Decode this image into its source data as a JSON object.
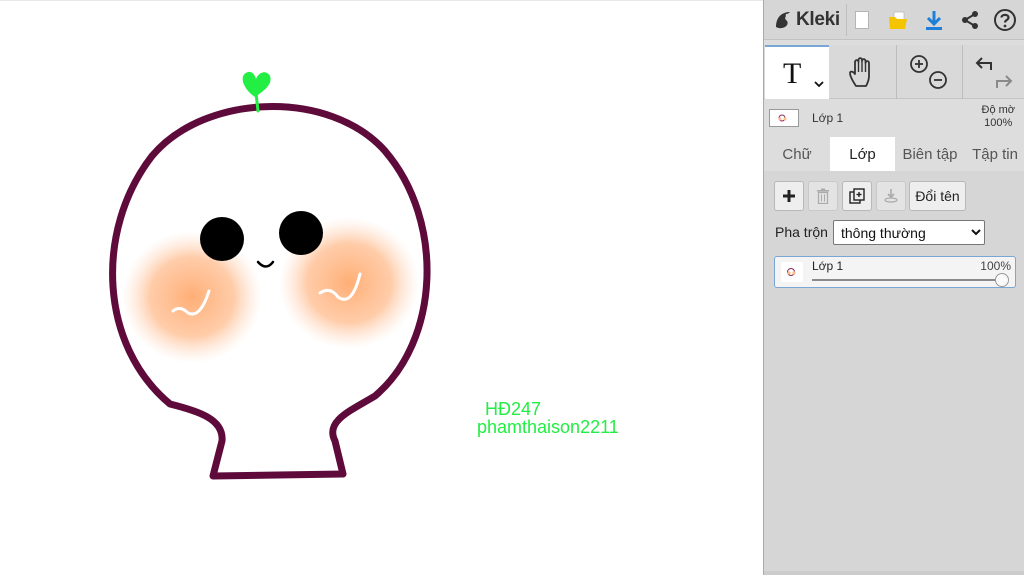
{
  "app": {
    "name": "Kleki"
  },
  "colors": {
    "outline": "#5e0b3b",
    "sprout": "#22ee44",
    "blush": "#ffb98a",
    "panel_bg": "#dddddd",
    "accent": "#1e7fd8",
    "folder": "#f5c400"
  },
  "canvas": {
    "texts": [
      "HĐ247",
      "phamthaison2211"
    ]
  },
  "toolbar": {
    "icons": [
      "kleki-logo-icon",
      "new-file-icon",
      "open-folder-icon",
      "download-icon",
      "share-icon",
      "help-icon"
    ]
  },
  "tools": {
    "text_tool_glyph": "T",
    "icons": [
      "text-tool-icon",
      "hand-tool-icon",
      "zoom-in-icon",
      "zoom-out-icon",
      "undo-icon",
      "redo-icon"
    ]
  },
  "layer_preview": {
    "name": "Lớp 1",
    "opacity_label": "Độ mờ",
    "opacity_value": "100%"
  },
  "tabs": [
    "Chữ",
    "Lớp",
    "Biên tập",
    "Tập tin"
  ],
  "active_tab": "Lớp",
  "layers_panel": {
    "rename_label": "Đổi tên",
    "blend_label": "Pha trộn",
    "blend_value": "thông thường",
    "layers": [
      {
        "name": "Lớp 1",
        "opacity": "100%",
        "opacity_fraction": 1.0
      }
    ]
  }
}
